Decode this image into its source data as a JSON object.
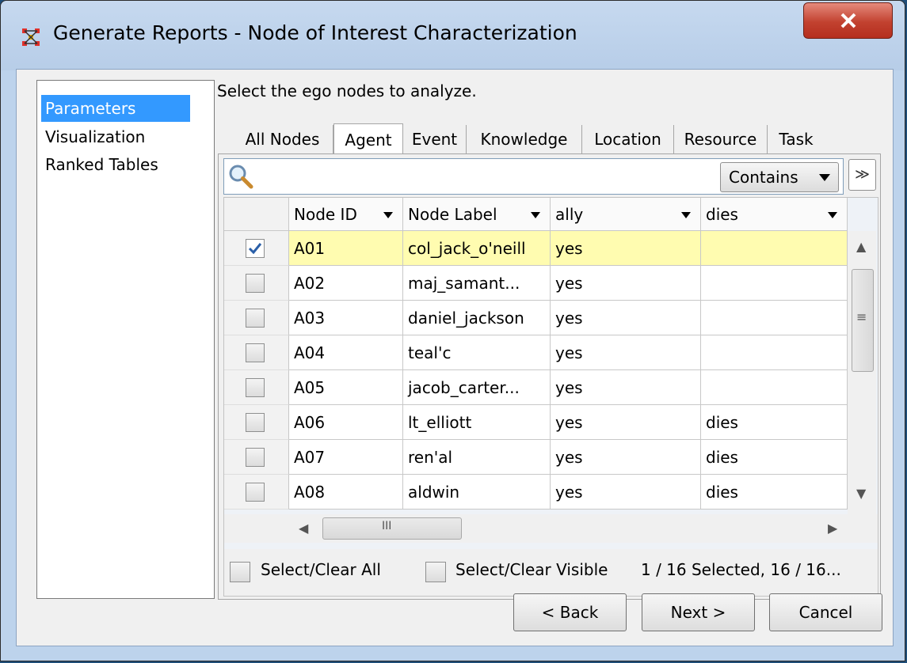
{
  "window": {
    "title": "Generate Reports - Node of Interest Characterization",
    "close_glyph": "X"
  },
  "nav": {
    "items": [
      {
        "label": "Parameters",
        "selected": true
      },
      {
        "label": "Visualization",
        "selected": false
      },
      {
        "label": "Ranked Tables",
        "selected": false
      }
    ]
  },
  "main": {
    "instructions": "Select the ego nodes to analyze.",
    "tabs": [
      {
        "label": "All Nodes",
        "active": false
      },
      {
        "label": "Agent",
        "active": true
      },
      {
        "label": "Event",
        "active": false
      },
      {
        "label": "Knowledge",
        "active": false
      },
      {
        "label": "Location",
        "active": false
      },
      {
        "label": "Resource",
        "active": false
      },
      {
        "label": "Task",
        "active": false
      }
    ],
    "search": {
      "value": "",
      "match_mode": "Contains",
      "expand_glyph": "≫"
    },
    "table": {
      "columns": [
        "Node ID",
        "Node Label",
        "ally",
        "dies"
      ],
      "rows": [
        {
          "checked": true,
          "id": "A01",
          "label": "col_jack_o'neill",
          "ally": "yes",
          "dies": ""
        },
        {
          "checked": false,
          "id": "A02",
          "label": "maj_samant...",
          "ally": "yes",
          "dies": ""
        },
        {
          "checked": false,
          "id": "A03",
          "label": "daniel_jackson",
          "ally": "yes",
          "dies": ""
        },
        {
          "checked": false,
          "id": "A04",
          "label": "teal'c",
          "ally": "yes",
          "dies": ""
        },
        {
          "checked": false,
          "id": "A05",
          "label": "jacob_carter...",
          "ally": "yes",
          "dies": ""
        },
        {
          "checked": false,
          "id": "A06",
          "label": "lt_elliott",
          "ally": "yes",
          "dies": "dies"
        },
        {
          "checked": false,
          "id": "A07",
          "label": "ren'al",
          "ally": "yes",
          "dies": "dies"
        },
        {
          "checked": false,
          "id": "A08",
          "label": "aldwin",
          "ally": "yes",
          "dies": "dies"
        }
      ],
      "hscroll_grip": "III",
      "vscroll_grip": "≡"
    },
    "footer": {
      "select_all_label": "Select/Clear All",
      "select_visible_label": "Select/Clear Visible",
      "status": "1 / 16 Selected, 16 / 16..."
    }
  },
  "buttons": {
    "back": "< Back",
    "next": "Next >",
    "cancel": "Cancel"
  },
  "colors": {
    "selection": "#3399ff",
    "row_highlight": "#fffcb0",
    "close_button": "#c2412f",
    "frame": "#bdd3ec"
  }
}
